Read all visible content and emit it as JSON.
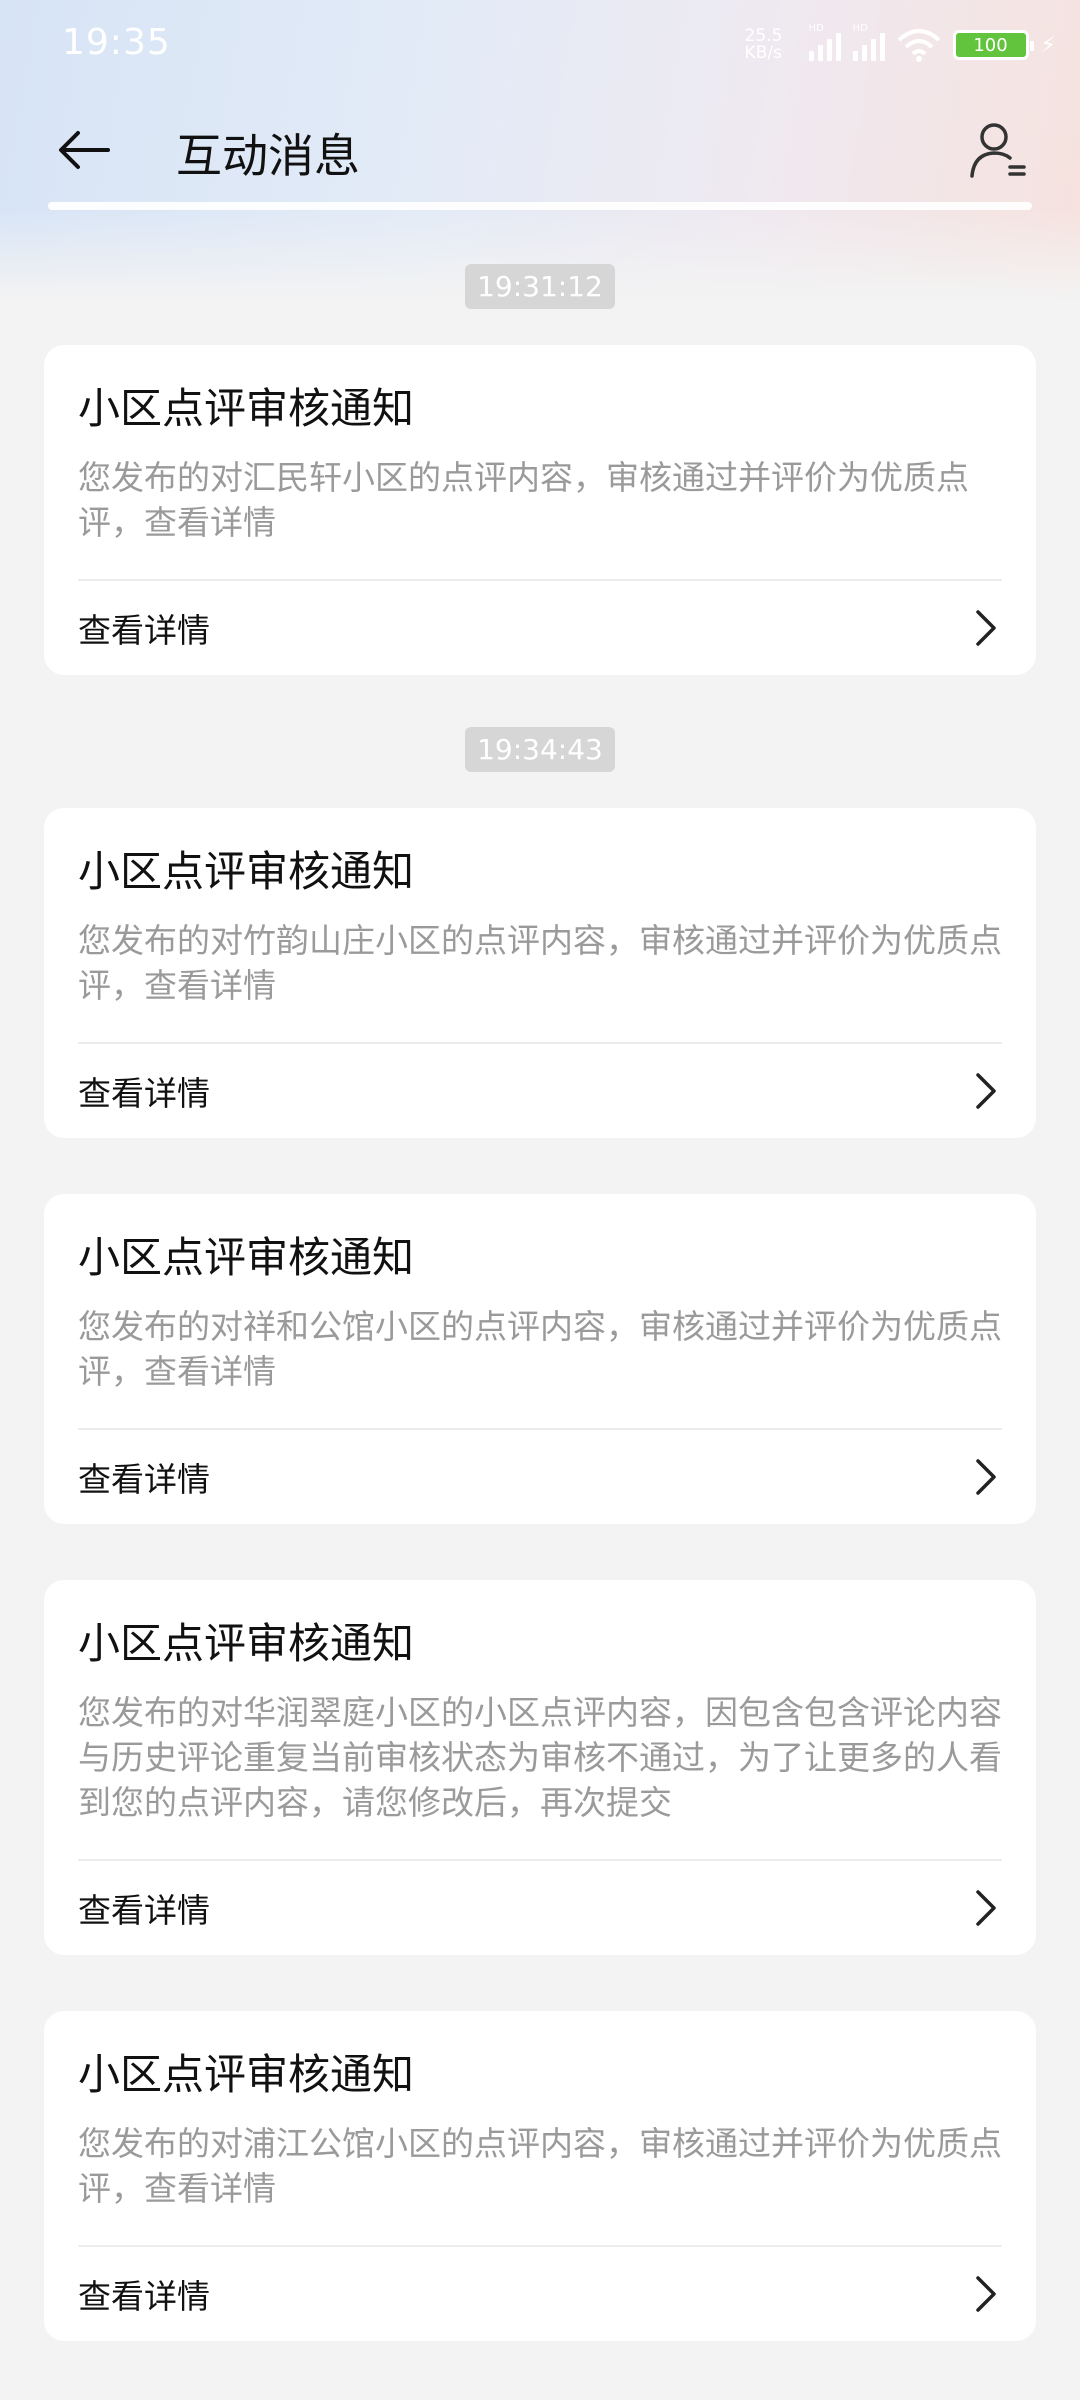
{
  "status_bar": {
    "time": "19:35",
    "net_speed_value": "25.5",
    "net_speed_unit": "KB/s",
    "signal_tag": "HD",
    "battery": "100"
  },
  "app_bar": {
    "title": "互动消息"
  },
  "messages": [
    {
      "timestamp": "19:31:12",
      "title": "小区点评审核通知",
      "body": "您发布的对汇民轩小区的点评内容，审核通过并评价为优质点评，查看详情",
      "action": "查看详情"
    },
    {
      "timestamp": "19:34:43",
      "title": "小区点评审核通知",
      "body": "您发布的对竹韵山庄小区的点评内容，审核通过并评价为优质点评，查看详情",
      "action": "查看详情"
    },
    {
      "title": "小区点评审核通知",
      "body": "您发布的对祥和公馆小区的点评内容，审核通过并评价为优质点评，查看详情",
      "action": "查看详情"
    },
    {
      "title": "小区点评审核通知",
      "body": "您发布的对华润翠庭小区的小区点评内容，因包含包含评论内容与历史评论重复当前审核状态为审核不通过，为了让更多的人看到您的点评内容，请您修改后，再次提交",
      "action": "查看详情"
    },
    {
      "title": "小区点评审核通知",
      "body": "您发布的对浦江公馆小区的点评内容，审核通过并评价为优质点评，查看详情",
      "action": "查看详情"
    }
  ]
}
